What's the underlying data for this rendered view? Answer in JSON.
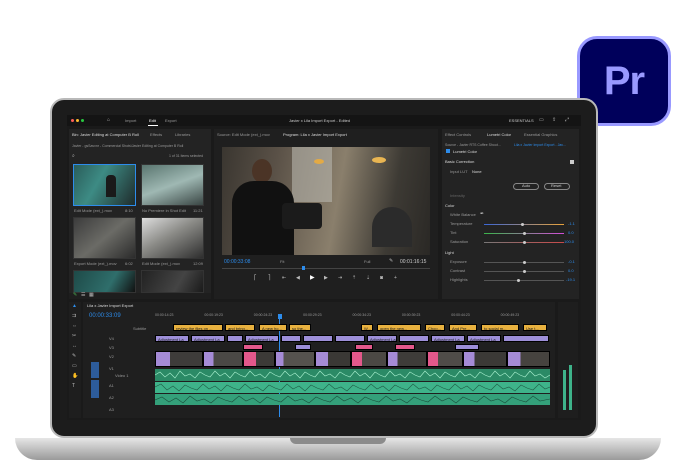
{
  "logo": {
    "text": "Pr"
  },
  "menubar": {
    "tabs": [
      "Import",
      "Edit",
      "Export"
    ],
    "title": "Javier x Lila Import Export - Edited",
    "workspace": "ESSENTIALS"
  },
  "project_panel": {
    "tabs": [
      "Bin: Javier Editing at Computer B Roll",
      "Effects",
      "Libraries"
    ],
    "path": "Javier - gsSavvnr - Commercial Shots\\Javier Editing at Computer B Roll",
    "selection": "1 of 31 items selected",
    "clips": [
      {
        "name": "Edit Mode (ext_).mov",
        "dur": "8:10"
      },
      {
        "name": "No Premiere in Shot Edit",
        "dur": "11:21"
      },
      {
        "name": "Export Mode (ext_).mov",
        "dur": "6:02"
      },
      {
        "name": "Edit Mode (ext_).mov",
        "dur": "12:09"
      },
      {
        "name": "",
        "dur": ""
      },
      {
        "name": "",
        "dur": ""
      }
    ]
  },
  "source_monitor": {
    "tab": "Source: Edit Mode (ext_).mov"
  },
  "program_monitor": {
    "tab": "Program: Lila x Javier Import Export",
    "timecode_in": "00:00:33:08",
    "fit": "Fit",
    "full": "Full",
    "timecode_out": "00:01:16:15"
  },
  "lumetri": {
    "tabs": [
      "Effect Controls",
      "Lumetri Color",
      "Essential Graphics"
    ],
    "source": "Source - Javier RTS Coffee Shoot...",
    "target": "Lila x Javier Import Export - Jav...",
    "effect": "Lumetri Color",
    "basic_correction": "Basic Correction",
    "input_lut_label": "Input LUT",
    "input_lut_value": "None",
    "auto": "Auto",
    "reset": "Reset",
    "intensity": "Intensity",
    "color_section": "Color",
    "white_balance": "White Balance",
    "sliders": [
      {
        "label": "Temperature",
        "value": "-1.1",
        "pos": 0.47
      },
      {
        "label": "Tint",
        "value": "0.0",
        "pos": 0.5
      },
      {
        "label": "Saturation",
        "value": "100.0",
        "pos": 0.5
      }
    ],
    "light_section": "Light",
    "light_sliders": [
      {
        "label": "Exposure",
        "value": "-0.1",
        "pos": 0.5
      },
      {
        "label": "Contrast",
        "value": "0.0",
        "pos": 0.5
      },
      {
        "label": "Highlights",
        "value": "-19.1",
        "pos": 0.42
      }
    ]
  },
  "timeline": {
    "tab": "Lila x Javier Import Export",
    "timecode": "00:00:33:09",
    "ruler": [
      "00:00:14:23",
      "00:00:19:23",
      "00:00:24:23",
      "00:00:29:23",
      "00:00:34:23",
      "00:00:39:23",
      "00:00:44:23",
      "00:00:49:23"
    ],
    "subtitle_track": "Subtitle",
    "subtitles": [
      "review the files on ...",
      "and bring...",
      "A new ho...",
      "so the...",
      "W...",
      "open the new...",
      "Choo...",
      "And Pre...",
      "to social m...",
      "Use t..."
    ],
    "adjustment_label": "Adjustment La",
    "video_track": "Video 1",
    "tracks": [
      "V4",
      "V3",
      "V2",
      "V1",
      "A1",
      "A2",
      "A3"
    ]
  },
  "colors": {
    "accent": "#2d8ceb",
    "subtitle": "#e8b13f",
    "adjustment": "#9d8fd8",
    "video": "#a58bd6",
    "pink": "#e3588b",
    "audio": "#3eb38a"
  }
}
